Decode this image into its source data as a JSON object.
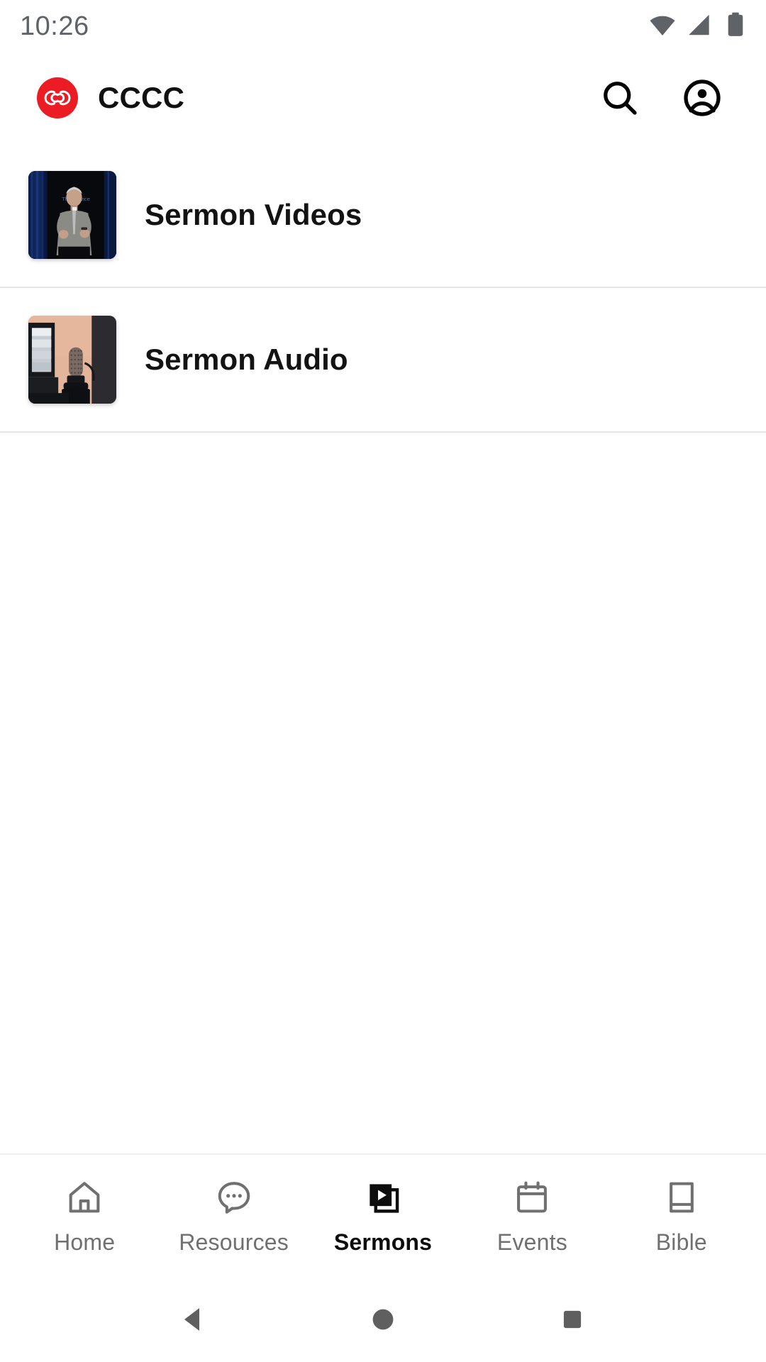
{
  "status_bar": {
    "time": "10:26",
    "icons": [
      "wifi-icon",
      "cellular-signal-icon",
      "battery-icon"
    ],
    "text_color": "#5f6368"
  },
  "app_bar": {
    "title": "CCCC",
    "logo": {
      "name": "cccc-logo-icon",
      "background_color": "#ec1c24",
      "mark_color": "#ffffff"
    },
    "actions": [
      {
        "name": "search-icon",
        "label": "Search"
      },
      {
        "name": "account-circle-icon",
        "label": "Account"
      }
    ]
  },
  "main": {
    "list_items": [
      {
        "label": "Sermon Videos",
        "thumbnail": "speaker-on-stage-thumbnail"
      },
      {
        "label": "Sermon Audio",
        "thumbnail": "studio-microphone-thumbnail"
      }
    ]
  },
  "bottom_nav": {
    "active": "Sermons",
    "items": [
      {
        "label": "Home",
        "icon": "home-icon",
        "active": false
      },
      {
        "label": "Resources",
        "icon": "chat-bubble-icon",
        "active": false
      },
      {
        "label": "Sermons",
        "icon": "video-library-icon",
        "active": true
      },
      {
        "label": "Events",
        "icon": "calendar-icon",
        "active": false
      },
      {
        "label": "Bible",
        "icon": "book-icon",
        "active": false
      }
    ],
    "inactive_color": "#707070",
    "active_color": "#0d0d0d"
  },
  "system_nav": {
    "buttons": [
      {
        "name": "back-button",
        "icon": "triangle-left-icon"
      },
      {
        "name": "home-button",
        "icon": "circle-icon"
      },
      {
        "name": "recents-button",
        "icon": "square-icon"
      }
    ],
    "color": "#5f5f5f"
  }
}
